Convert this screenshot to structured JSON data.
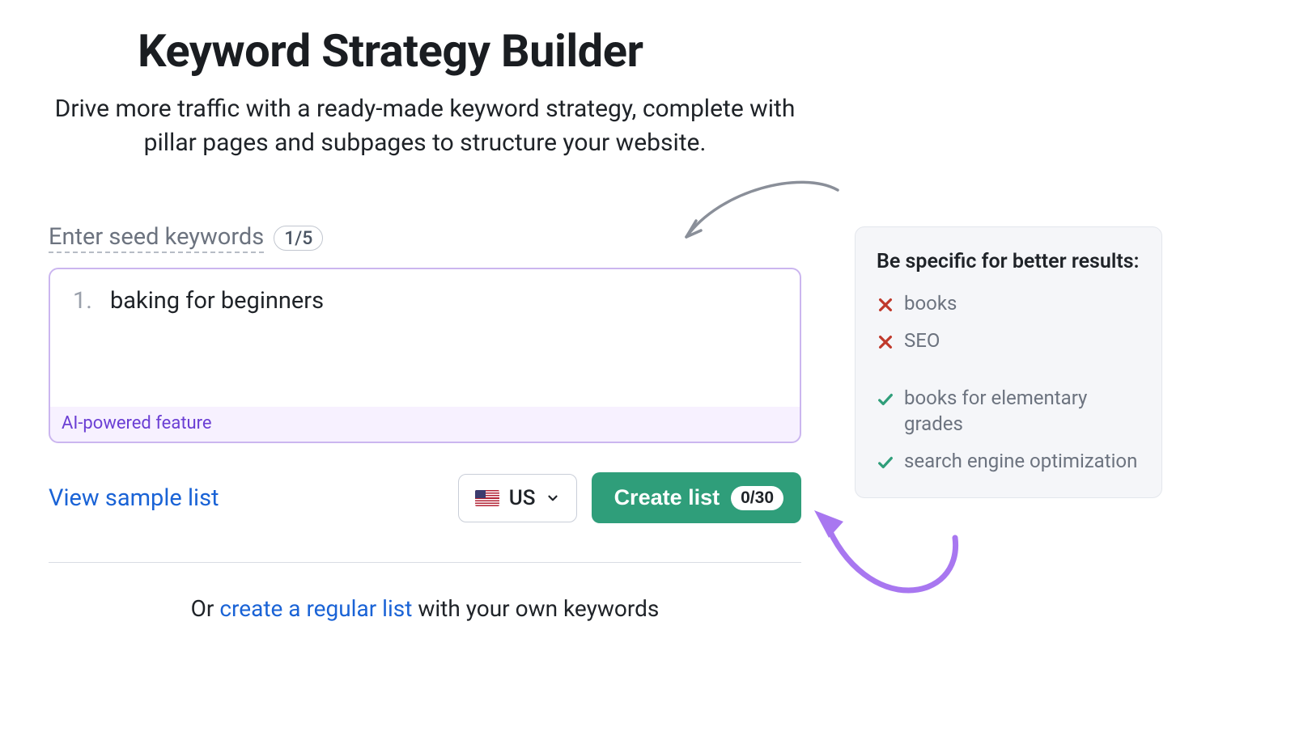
{
  "header": {
    "title": "Keyword Strategy Builder",
    "subtitle": "Drive more traffic with a ready-made keyword strategy, complete with pillar pages and subpages to structure your website."
  },
  "seed": {
    "label": "Enter seed keywords",
    "count": "1/5",
    "item_number": "1.",
    "item_value": "baking for beginners",
    "ai_label": "AI-powered feature"
  },
  "actions": {
    "sample_link": "View sample list",
    "country_code": "US",
    "create_label": "Create list",
    "create_count": "0/30"
  },
  "alt": {
    "prefix": "Or ",
    "link": "create a regular list",
    "suffix": " with your own keywords"
  },
  "tips": {
    "title": "Be specific for better results:",
    "bad": [
      "books",
      "SEO"
    ],
    "good": [
      "books for elementary grades",
      "search engine optimization"
    ]
  }
}
